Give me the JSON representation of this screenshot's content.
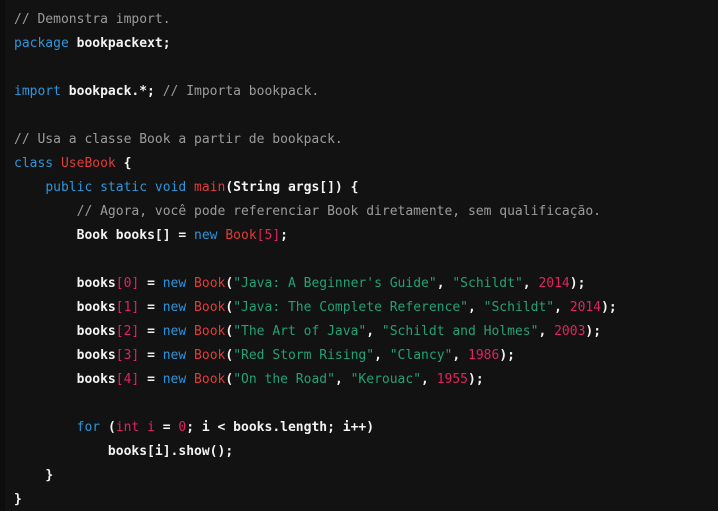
{
  "editor": {
    "language": "Java",
    "background": "#0d0d0d",
    "surface": "#121212",
    "colors": {
      "comment": "#9b9b9b",
      "keyword": "#2a96dd",
      "type": "#e03b3b",
      "string": "#21a179",
      "number": "#e0245e",
      "plain": "#f2f2f2",
      "bracket": "#e0245e"
    }
  },
  "code": {
    "lines": [
      {
        "n": 1,
        "indent": 0,
        "tokens": [
          {
            "t": "comment",
            "v": "// Demonstra import."
          }
        ]
      },
      {
        "n": 2,
        "indent": 0,
        "tokens": [
          {
            "t": "keyword",
            "v": "package"
          },
          {
            "t": "plain",
            "v": " bookpackext;"
          }
        ]
      },
      {
        "n": 3,
        "indent": 0,
        "tokens": []
      },
      {
        "n": 4,
        "indent": 0,
        "tokens": [
          {
            "t": "keyword",
            "v": "import"
          },
          {
            "t": "plain",
            "v": " bookpack.*; "
          },
          {
            "t": "comment",
            "v": "// Importa bookpack."
          }
        ]
      },
      {
        "n": 5,
        "indent": 0,
        "tokens": []
      },
      {
        "n": 6,
        "indent": 0,
        "tokens": [
          {
            "t": "comment",
            "v": "// Usa a classe Book a partir de bookpack."
          }
        ]
      },
      {
        "n": 7,
        "indent": 0,
        "tokens": [
          {
            "t": "keyword",
            "v": "class"
          },
          {
            "t": "plain",
            "v": " "
          },
          {
            "t": "type",
            "v": "UseBook"
          },
          {
            "t": "punct",
            "v": " {"
          }
        ]
      },
      {
        "n": 8,
        "indent": 1,
        "tokens": [
          {
            "t": "keyword",
            "v": "public static void"
          },
          {
            "t": "plain",
            "v": " "
          },
          {
            "t": "type",
            "v": "main"
          },
          {
            "t": "punct",
            "v": "("
          },
          {
            "t": "plain",
            "v": "String args[]"
          },
          {
            "t": "punct",
            "v": ") {"
          }
        ]
      },
      {
        "n": 9,
        "indent": 2,
        "tokens": [
          {
            "t": "comment",
            "v": "// Agora, você pode referenciar Book diretamente, sem qualificação."
          }
        ]
      },
      {
        "n": 10,
        "indent": 2,
        "tokens": [
          {
            "t": "plain",
            "v": "Book books[] = "
          },
          {
            "t": "keyword",
            "v": "new"
          },
          {
            "t": "plain",
            "v": " "
          },
          {
            "t": "type",
            "v": "Book"
          },
          {
            "t": "bracket",
            "v": "["
          },
          {
            "t": "number",
            "v": "5"
          },
          {
            "t": "bracket",
            "v": "]"
          },
          {
            "t": "punct",
            "v": ";"
          }
        ]
      },
      {
        "n": 11,
        "indent": 0,
        "tokens": []
      },
      {
        "n": 12,
        "indent": 2,
        "tokens": [
          {
            "t": "plain",
            "v": "books"
          },
          {
            "t": "bracket",
            "v": "["
          },
          {
            "t": "number",
            "v": "0"
          },
          {
            "t": "bracket",
            "v": "]"
          },
          {
            "t": "plain",
            "v": " = "
          },
          {
            "t": "keyword",
            "v": "new"
          },
          {
            "t": "plain",
            "v": " "
          },
          {
            "t": "type",
            "v": "Book"
          },
          {
            "t": "punct",
            "v": "("
          },
          {
            "t": "string",
            "v": "\"Java: A Beginner's Guide\""
          },
          {
            "t": "punct",
            "v": ", "
          },
          {
            "t": "string",
            "v": "\"Schildt\""
          },
          {
            "t": "punct",
            "v": ", "
          },
          {
            "t": "number",
            "v": "2014"
          },
          {
            "t": "punct",
            "v": ");"
          }
        ]
      },
      {
        "n": 13,
        "indent": 2,
        "tokens": [
          {
            "t": "plain",
            "v": "books"
          },
          {
            "t": "bracket",
            "v": "["
          },
          {
            "t": "number",
            "v": "1"
          },
          {
            "t": "bracket",
            "v": "]"
          },
          {
            "t": "plain",
            "v": " = "
          },
          {
            "t": "keyword",
            "v": "new"
          },
          {
            "t": "plain",
            "v": " "
          },
          {
            "t": "type",
            "v": "Book"
          },
          {
            "t": "punct",
            "v": "("
          },
          {
            "t": "string",
            "v": "\"Java: The Complete Reference\""
          },
          {
            "t": "punct",
            "v": ", "
          },
          {
            "t": "string",
            "v": "\"Schildt\""
          },
          {
            "t": "punct",
            "v": ", "
          },
          {
            "t": "number",
            "v": "2014"
          },
          {
            "t": "punct",
            "v": ");"
          }
        ]
      },
      {
        "n": 14,
        "indent": 2,
        "tokens": [
          {
            "t": "plain",
            "v": "books"
          },
          {
            "t": "bracket",
            "v": "["
          },
          {
            "t": "number",
            "v": "2"
          },
          {
            "t": "bracket",
            "v": "]"
          },
          {
            "t": "plain",
            "v": " = "
          },
          {
            "t": "keyword",
            "v": "new"
          },
          {
            "t": "plain",
            "v": " "
          },
          {
            "t": "type",
            "v": "Book"
          },
          {
            "t": "punct",
            "v": "("
          },
          {
            "t": "string",
            "v": "\"The Art of Java\""
          },
          {
            "t": "punct",
            "v": ", "
          },
          {
            "t": "string",
            "v": "\"Schildt and Holmes\""
          },
          {
            "t": "punct",
            "v": ", "
          },
          {
            "t": "number",
            "v": "2003"
          },
          {
            "t": "punct",
            "v": ");"
          }
        ]
      },
      {
        "n": 15,
        "indent": 2,
        "tokens": [
          {
            "t": "plain",
            "v": "books"
          },
          {
            "t": "bracket",
            "v": "["
          },
          {
            "t": "number",
            "v": "3"
          },
          {
            "t": "bracket",
            "v": "]"
          },
          {
            "t": "plain",
            "v": " = "
          },
          {
            "t": "keyword",
            "v": "new"
          },
          {
            "t": "plain",
            "v": " "
          },
          {
            "t": "type",
            "v": "Book"
          },
          {
            "t": "punct",
            "v": "("
          },
          {
            "t": "string",
            "v": "\"Red Storm Rising\""
          },
          {
            "t": "punct",
            "v": ", "
          },
          {
            "t": "string",
            "v": "\"Clancy\""
          },
          {
            "t": "punct",
            "v": ", "
          },
          {
            "t": "number",
            "v": "1986"
          },
          {
            "t": "punct",
            "v": ");"
          }
        ]
      },
      {
        "n": 16,
        "indent": 2,
        "tokens": [
          {
            "t": "plain",
            "v": "books"
          },
          {
            "t": "bracket",
            "v": "["
          },
          {
            "t": "number",
            "v": "4"
          },
          {
            "t": "bracket",
            "v": "]"
          },
          {
            "t": "plain",
            "v": " = "
          },
          {
            "t": "keyword",
            "v": "new"
          },
          {
            "t": "plain",
            "v": " "
          },
          {
            "t": "type",
            "v": "Book"
          },
          {
            "t": "punct",
            "v": "("
          },
          {
            "t": "string",
            "v": "\"On the Road\""
          },
          {
            "t": "punct",
            "v": ", "
          },
          {
            "t": "string",
            "v": "\"Kerouac\""
          },
          {
            "t": "punct",
            "v": ", "
          },
          {
            "t": "number",
            "v": "1955"
          },
          {
            "t": "punct",
            "v": ");"
          }
        ]
      },
      {
        "n": 17,
        "indent": 0,
        "tokens": []
      },
      {
        "n": 18,
        "indent": 2,
        "tokens": [
          {
            "t": "keyword",
            "v": "for"
          },
          {
            "t": "plain",
            "v": " "
          },
          {
            "t": "punct",
            "v": "("
          },
          {
            "t": "prim",
            "v": "int"
          },
          {
            "t": "plain",
            "v": " "
          },
          {
            "t": "var",
            "v": "i"
          },
          {
            "t": "plain",
            "v": " = "
          },
          {
            "t": "number",
            "v": "0"
          },
          {
            "t": "punct",
            "v": "; "
          },
          {
            "t": "plain",
            "v": "i < books.length; i++"
          },
          {
            "t": "punct",
            "v": ")"
          }
        ]
      },
      {
        "n": 19,
        "indent": 3,
        "tokens": [
          {
            "t": "plain",
            "v": "books[i].show();"
          }
        ]
      },
      {
        "n": 20,
        "indent": 1,
        "tokens": [
          {
            "t": "punct",
            "v": "}"
          }
        ]
      },
      {
        "n": 21,
        "indent": 0,
        "tokens": [
          {
            "t": "punct",
            "v": "}"
          }
        ]
      }
    ]
  }
}
